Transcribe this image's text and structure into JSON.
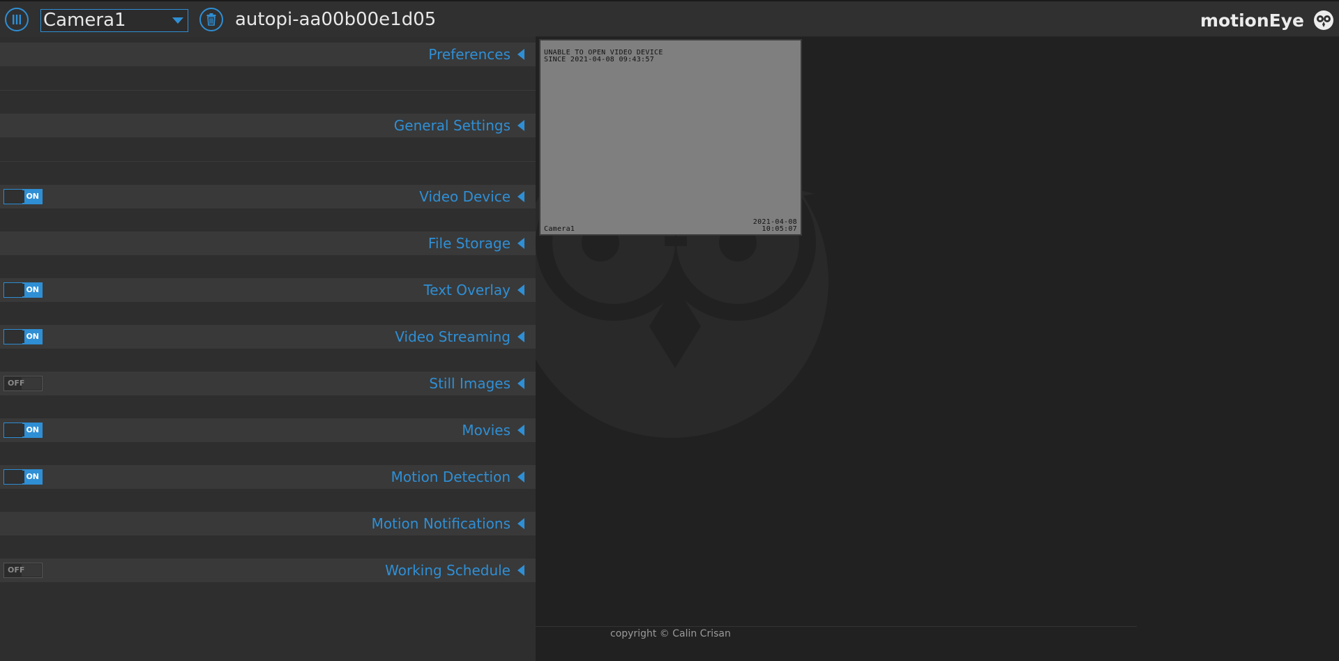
{
  "header": {
    "camera_selected": "Camera1",
    "hostname": "autopi-aa00b00e1d05",
    "brand": "motionEye"
  },
  "sections": [
    {
      "title": "Preferences",
      "toggle": null
    },
    {
      "title": "General Settings",
      "toggle": null
    },
    {
      "title": "Video Device",
      "toggle": "ON"
    },
    {
      "title": "File Storage",
      "toggle": null
    },
    {
      "title": "Text Overlay",
      "toggle": "ON"
    },
    {
      "title": "Video Streaming",
      "toggle": "ON"
    },
    {
      "title": "Still Images",
      "toggle": "OFF"
    },
    {
      "title": "Movies",
      "toggle": "ON"
    },
    {
      "title": "Motion Detection",
      "toggle": "ON"
    },
    {
      "title": "Motion Notifications",
      "toggle": null
    },
    {
      "title": "Working Schedule",
      "toggle": "OFF"
    }
  ],
  "camera_frame": {
    "error_line1": "UNABLE TO OPEN VIDEO DEVICE",
    "error_line2": "SINCE 2021-04-08 09:43:57",
    "camera_name": "Camera1",
    "date": "2021-04-08",
    "time": "10:05:07"
  },
  "footer": {
    "copyright": "copyright © Calin Crisan"
  },
  "colors": {
    "accent": "#2f8fd5",
    "panel_bg": "#2e2e2e",
    "section_bg": "#393939",
    "main_bg": "#212121"
  },
  "icons": {
    "menu": "columns-icon",
    "delete": "trash-icon",
    "logo": "owl-icon",
    "section_expand": "triangle-left-icon",
    "select_caret": "caret-down-icon"
  }
}
